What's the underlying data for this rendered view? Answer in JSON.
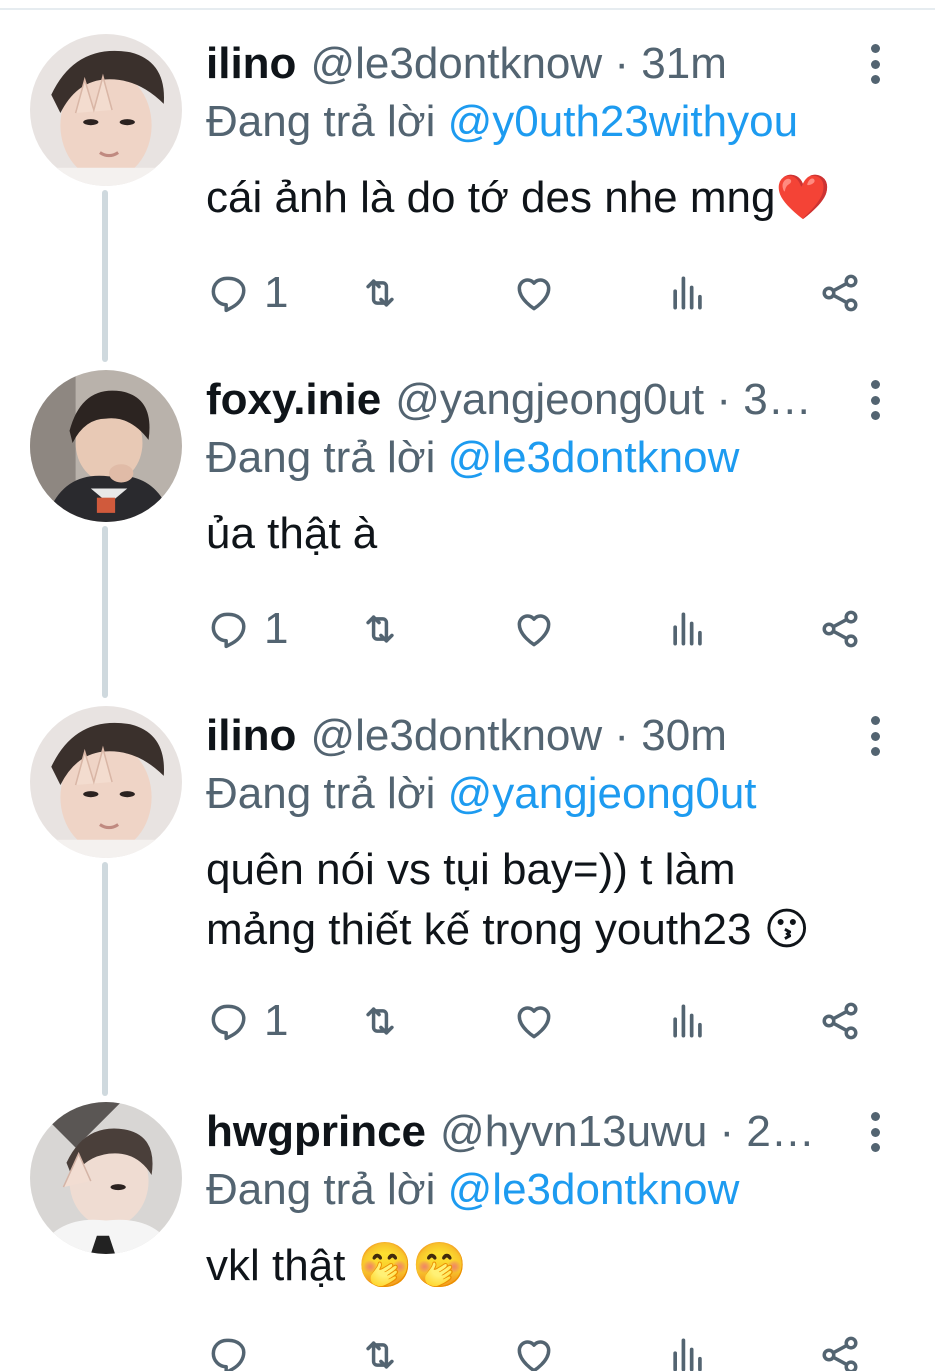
{
  "tweets": [
    {
      "name": "ilino",
      "meta": "@le3dontknow · 31m",
      "reply_prefix": "Đang trả lời",
      "reply_handle": "@y0uth23withyou",
      "text": "cái ảnh là do tớ des nhe mng",
      "text_emoji": "❤️",
      "reply_count": "1",
      "avatar": "ilino-avatar"
    },
    {
      "name": "foxy.inie",
      "meta": "@yangjeong0ut · 3…",
      "reply_prefix": "Đang trả lời",
      "reply_handle": "@le3dontknow",
      "text": "ủa thật à",
      "reply_count": "1",
      "avatar": "foxy-avatar"
    },
    {
      "name": "ilino",
      "meta": "@le3dontknow · 30m",
      "reply_prefix": "Đang trả lời",
      "reply_handle": "@yangjeong0ut",
      "text_line1": "quên nói vs tụi bay=)) t làm",
      "text_line2": "mảng thiết kế trong youth23",
      "text_emoji": "😗",
      "reply_count": "1",
      "avatar": "ilino-avatar"
    },
    {
      "name": "hwgprince",
      "meta": "@hyvn13uwu · 2…",
      "reply_prefix": "Đang trả lời",
      "reply_handle": "@le3dontknow",
      "text": "vkl thật",
      "text_emoji": "🤭🤭",
      "avatar": "hwgprince-avatar"
    }
  ],
  "icons": [
    "reply-icon",
    "retweet-icon",
    "like-icon",
    "views-icon",
    "share-icon",
    "more-icon"
  ],
  "colors": {
    "link": "#1d9bf0",
    "secondary": "#536471",
    "thread_line": "#cfd9de"
  }
}
